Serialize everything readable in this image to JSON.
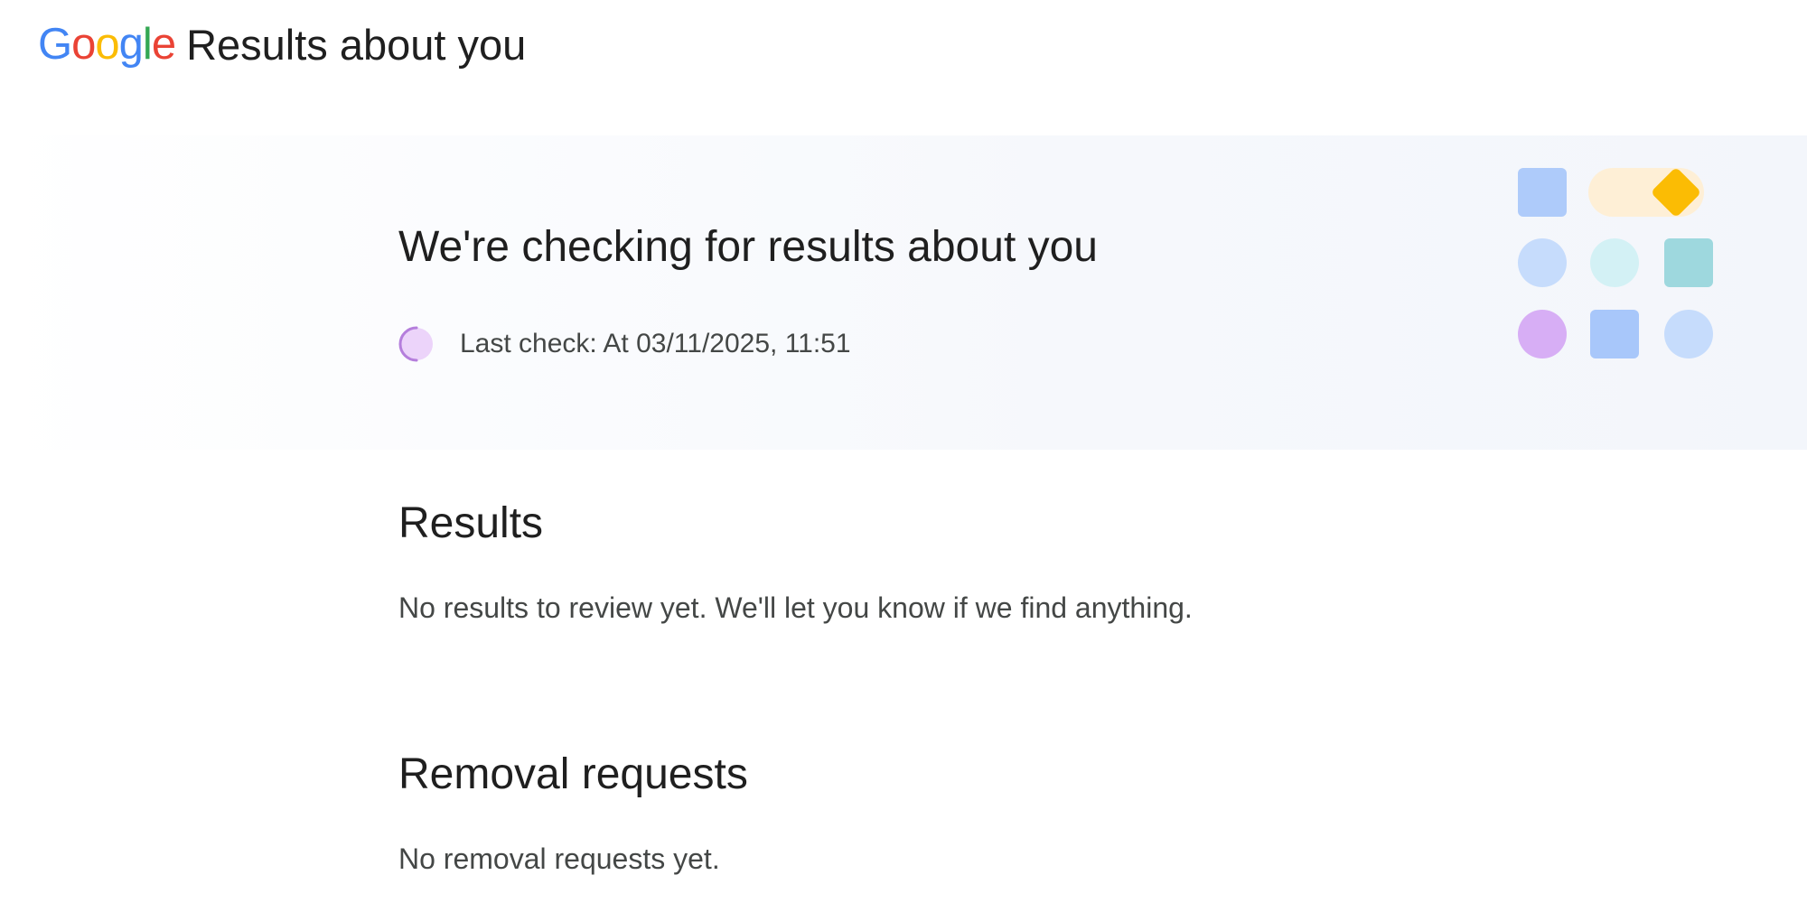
{
  "header": {
    "logo_letters": [
      {
        "char": "G",
        "color": "#4285F4"
      },
      {
        "char": "o",
        "color": "#EA4335"
      },
      {
        "char": "o",
        "color": "#FBBC05"
      },
      {
        "char": "g",
        "color": "#4285F4"
      },
      {
        "char": "l",
        "color": "#34A853"
      },
      {
        "char": "e",
        "color": "#EA4335"
      }
    ],
    "title": "Results about you"
  },
  "hero": {
    "title": "We're checking for results about you",
    "status": "Last check: At 03/11/2025, 11:51",
    "spinner_icon": "loading-spinner-icon",
    "illustration_icon": "shapes-illustration-icon"
  },
  "results": {
    "title": "Results",
    "message": "No results to review yet. We'll let you know if we find anything."
  },
  "removal": {
    "title": "Removal requests",
    "message": "No removal requests yet."
  }
}
